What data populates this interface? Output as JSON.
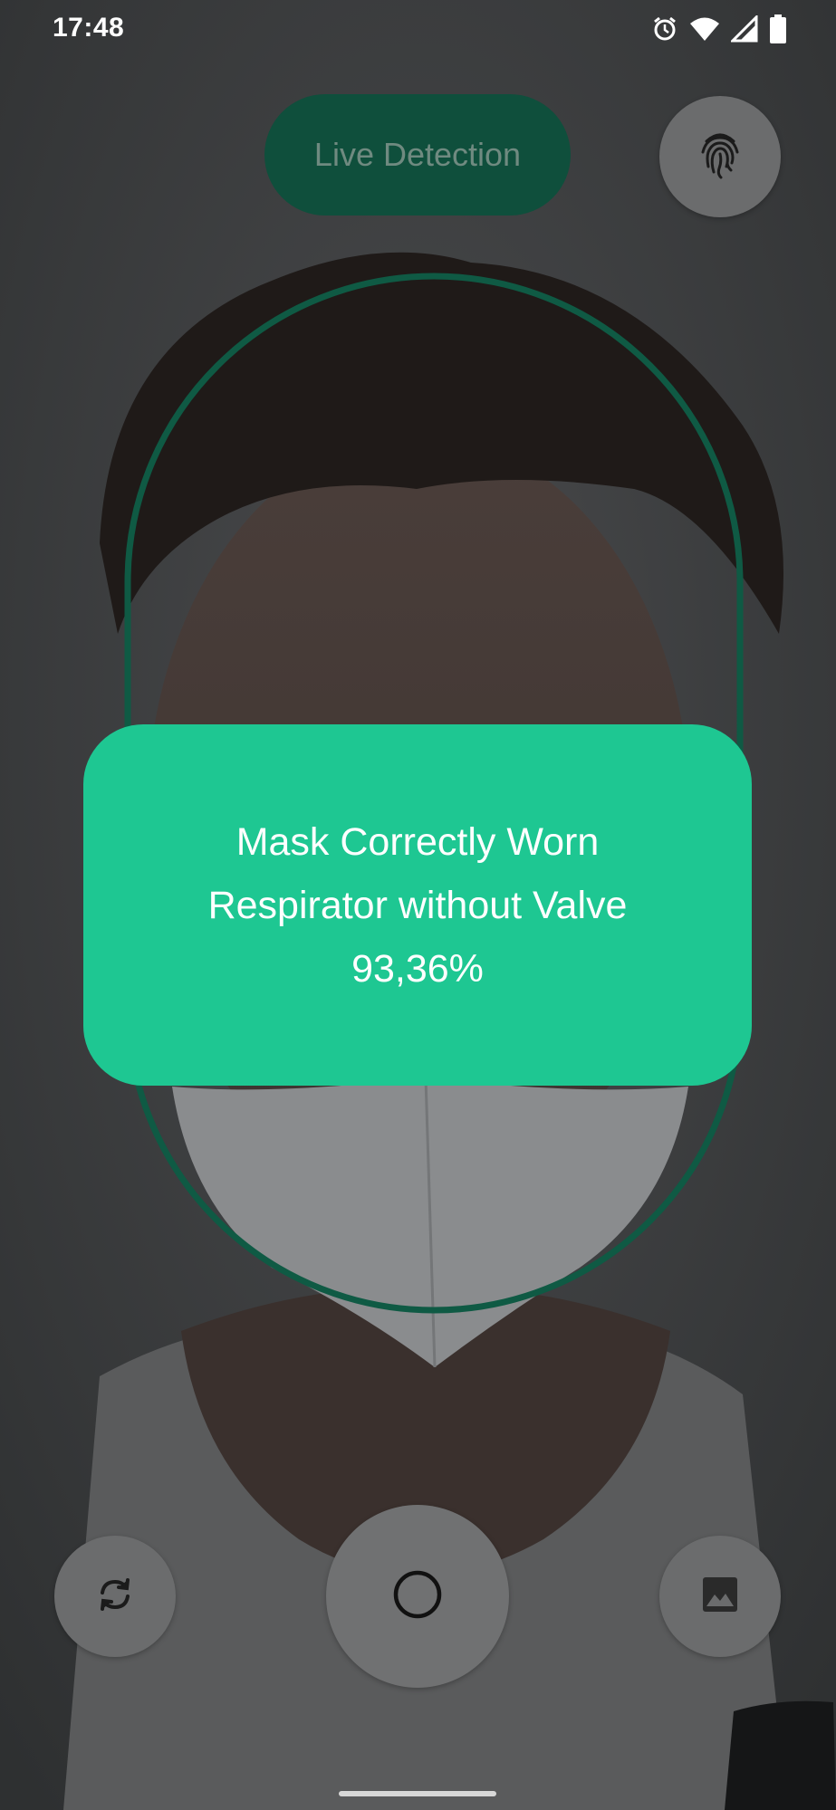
{
  "status_bar": {
    "time": "17:48",
    "icons": [
      "alarm-icon",
      "wifi-icon",
      "signal-icon",
      "battery-icon"
    ]
  },
  "header": {
    "live_detection_label": "Live Detection",
    "fingerprint_icon": "fingerprint-icon"
  },
  "result": {
    "line1": "Mask Correctly Worn",
    "line2": "Respirator without Valve",
    "confidence": "93,36%"
  },
  "controls": {
    "switch_camera_icon": "switch-camera-icon",
    "shutter_icon": "circle-icon",
    "gallery_icon": "gallery-icon"
  },
  "colors": {
    "accent_green": "#1ec792",
    "pill_green": "#0f4f3c",
    "oval_outline": "#0f5a44",
    "button_gray": "#6b6c6d"
  }
}
